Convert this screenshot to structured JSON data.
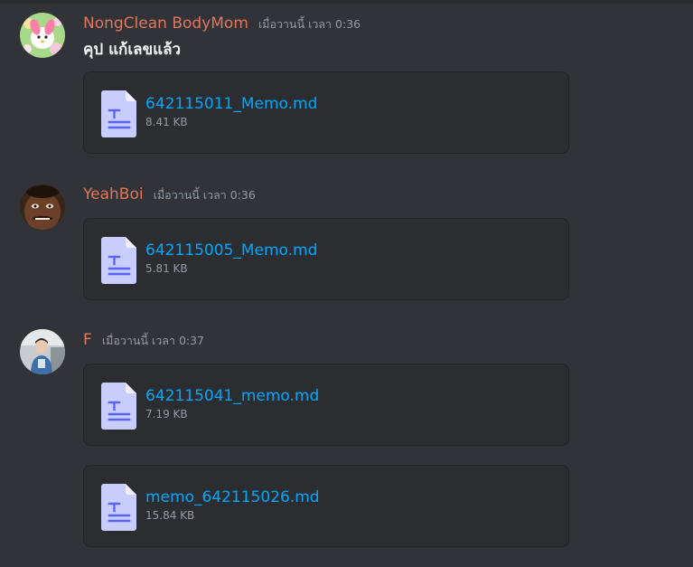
{
  "messages": [
    {
      "author": "NongClean BodyMom",
      "timestamp": "เมื่อวานนี้ เวลา 0:36",
      "text": "คุป แก้เลขแล้ว",
      "attachments": [
        {
          "name": "642115011_Memo.md",
          "size": "8.41 KB"
        }
      ]
    },
    {
      "author": "YeahBoi",
      "timestamp": "เมื่อวานนี้ เวลา 0:36",
      "attachments": [
        {
          "name": "642115005_Memo.md",
          "size": "5.81 KB"
        }
      ]
    },
    {
      "author": "F",
      "timestamp": "เมื่อวานนี้ เวลา 0:37",
      "attachments": [
        {
          "name": "642115041_memo.md",
          "size": "7.19 KB"
        },
        {
          "name": "memo_642115026.md",
          "size": "15.84 KB"
        }
      ]
    }
  ],
  "colors": {
    "background": "#313338",
    "attachment_bg": "#2b2d31",
    "username": "#e0765a",
    "link": "#00a8fc",
    "muted": "#949ba4",
    "text": "#f2f3f5",
    "file_icon": "#c9cdfb"
  },
  "icons": {
    "file": "text-file-icon"
  }
}
